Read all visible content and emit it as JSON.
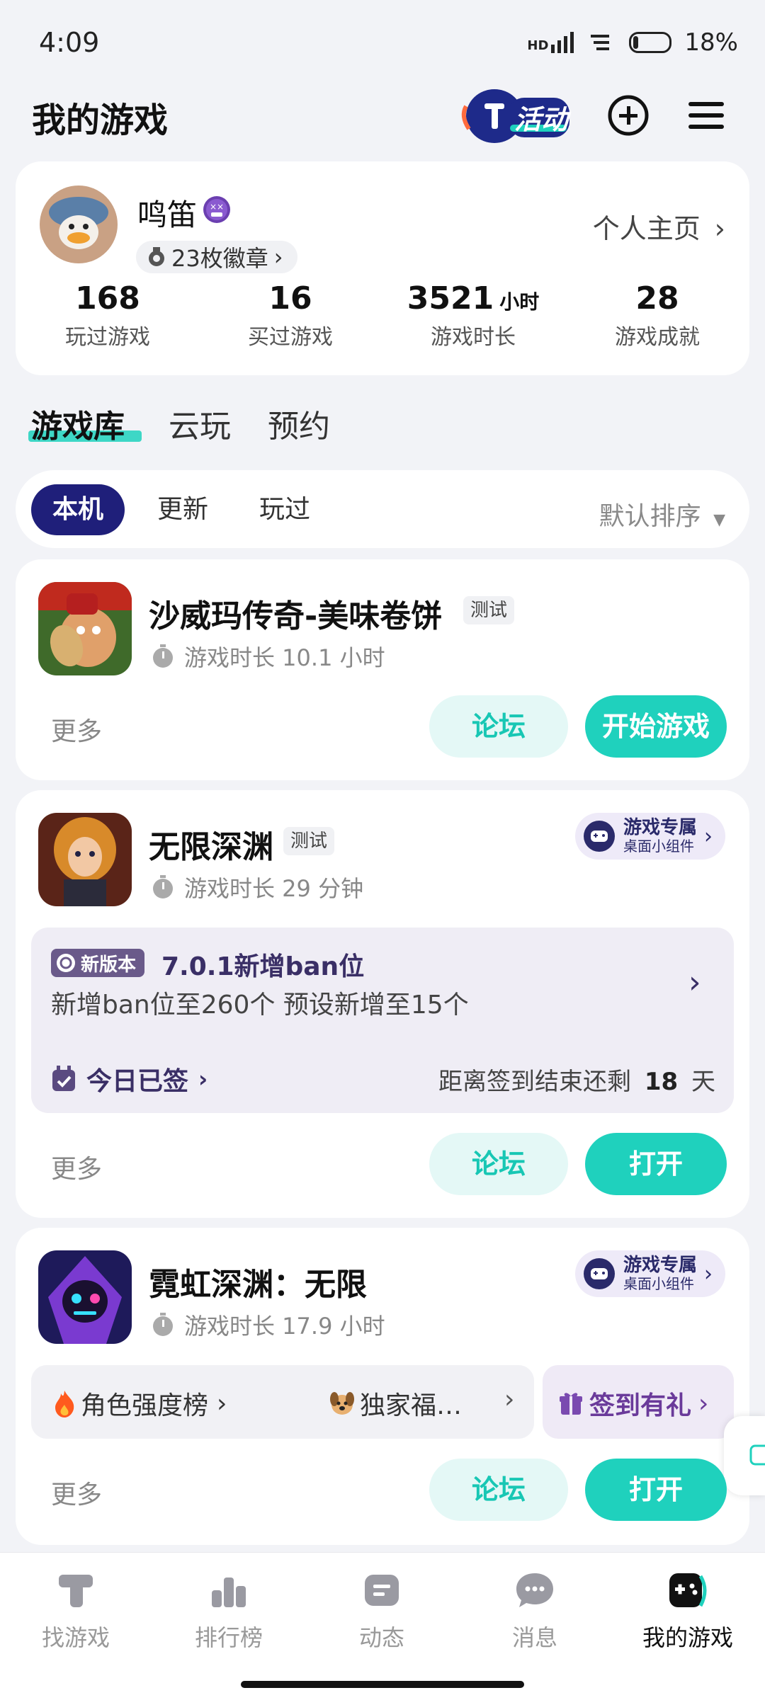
{
  "status_bar": {
    "time": "4:09",
    "network": "HD",
    "battery": "18%"
  },
  "header": {
    "title": "我的游戏",
    "activity_label": "活动"
  },
  "profile": {
    "name": "鸣笛",
    "badges": "23枚徽章",
    "home_link": "个人主页",
    "stats": [
      {
        "value": "168",
        "unit": "",
        "label": "玩过游戏"
      },
      {
        "value": "16",
        "unit": "",
        "label": "买过游戏"
      },
      {
        "value": "3521",
        "unit": "小时",
        "label": "游戏时长"
      },
      {
        "value": "28",
        "unit": "",
        "label": "游戏成就"
      }
    ]
  },
  "library_tabs": [
    "游戏库",
    "云玩",
    "预约"
  ],
  "filters": {
    "options": [
      "本机",
      "更新",
      "玩过"
    ],
    "sort": "默认排序"
  },
  "games": [
    {
      "title": "沙威玛传奇-美味卷饼",
      "tag": "测试",
      "playtime": "游戏时长 10.1 小时",
      "more": "更多",
      "forum": "论坛",
      "primary": "开始游戏"
    },
    {
      "title": "无限深渊",
      "tag": "测试",
      "playtime": "游戏时长 29 分钟",
      "widget_line1": "游戏专属",
      "widget_line2": "桌面小组件",
      "news_badge": "新版本",
      "news_title": "7.0.1新增ban位",
      "news_body": "新增ban位至260个 预设新增至15个",
      "checkin": "今日已签",
      "countdown_prefix": "距离签到结束还剩",
      "countdown_days": "18",
      "countdown_suffix": "天",
      "more": "更多",
      "forum": "论坛",
      "primary": "打开"
    },
    {
      "title": "霓虹深渊：无限",
      "playtime": "游戏时长 17.9 小时",
      "widget_line1": "游戏专属",
      "widget_line2": "桌面小组件",
      "shortcut1": "角色强度榜",
      "shortcut2": "独家福…",
      "shortcut3": "签到有礼",
      "more": "更多",
      "forum": "论坛",
      "primary": "打开"
    }
  ],
  "bottom_nav": [
    {
      "label": "找游戏",
      "icon": "t-logo-icon"
    },
    {
      "label": "排行榜",
      "icon": "ranking-icon"
    },
    {
      "label": "动态",
      "icon": "feed-icon"
    },
    {
      "label": "消息",
      "icon": "chat-icon"
    },
    {
      "label": "我的游戏",
      "icon": "gamepad-icon"
    }
  ],
  "colors": {
    "accent": "#1fd1bd",
    "active_pill": "#1f1f7a",
    "background": "#f2f3f7"
  }
}
